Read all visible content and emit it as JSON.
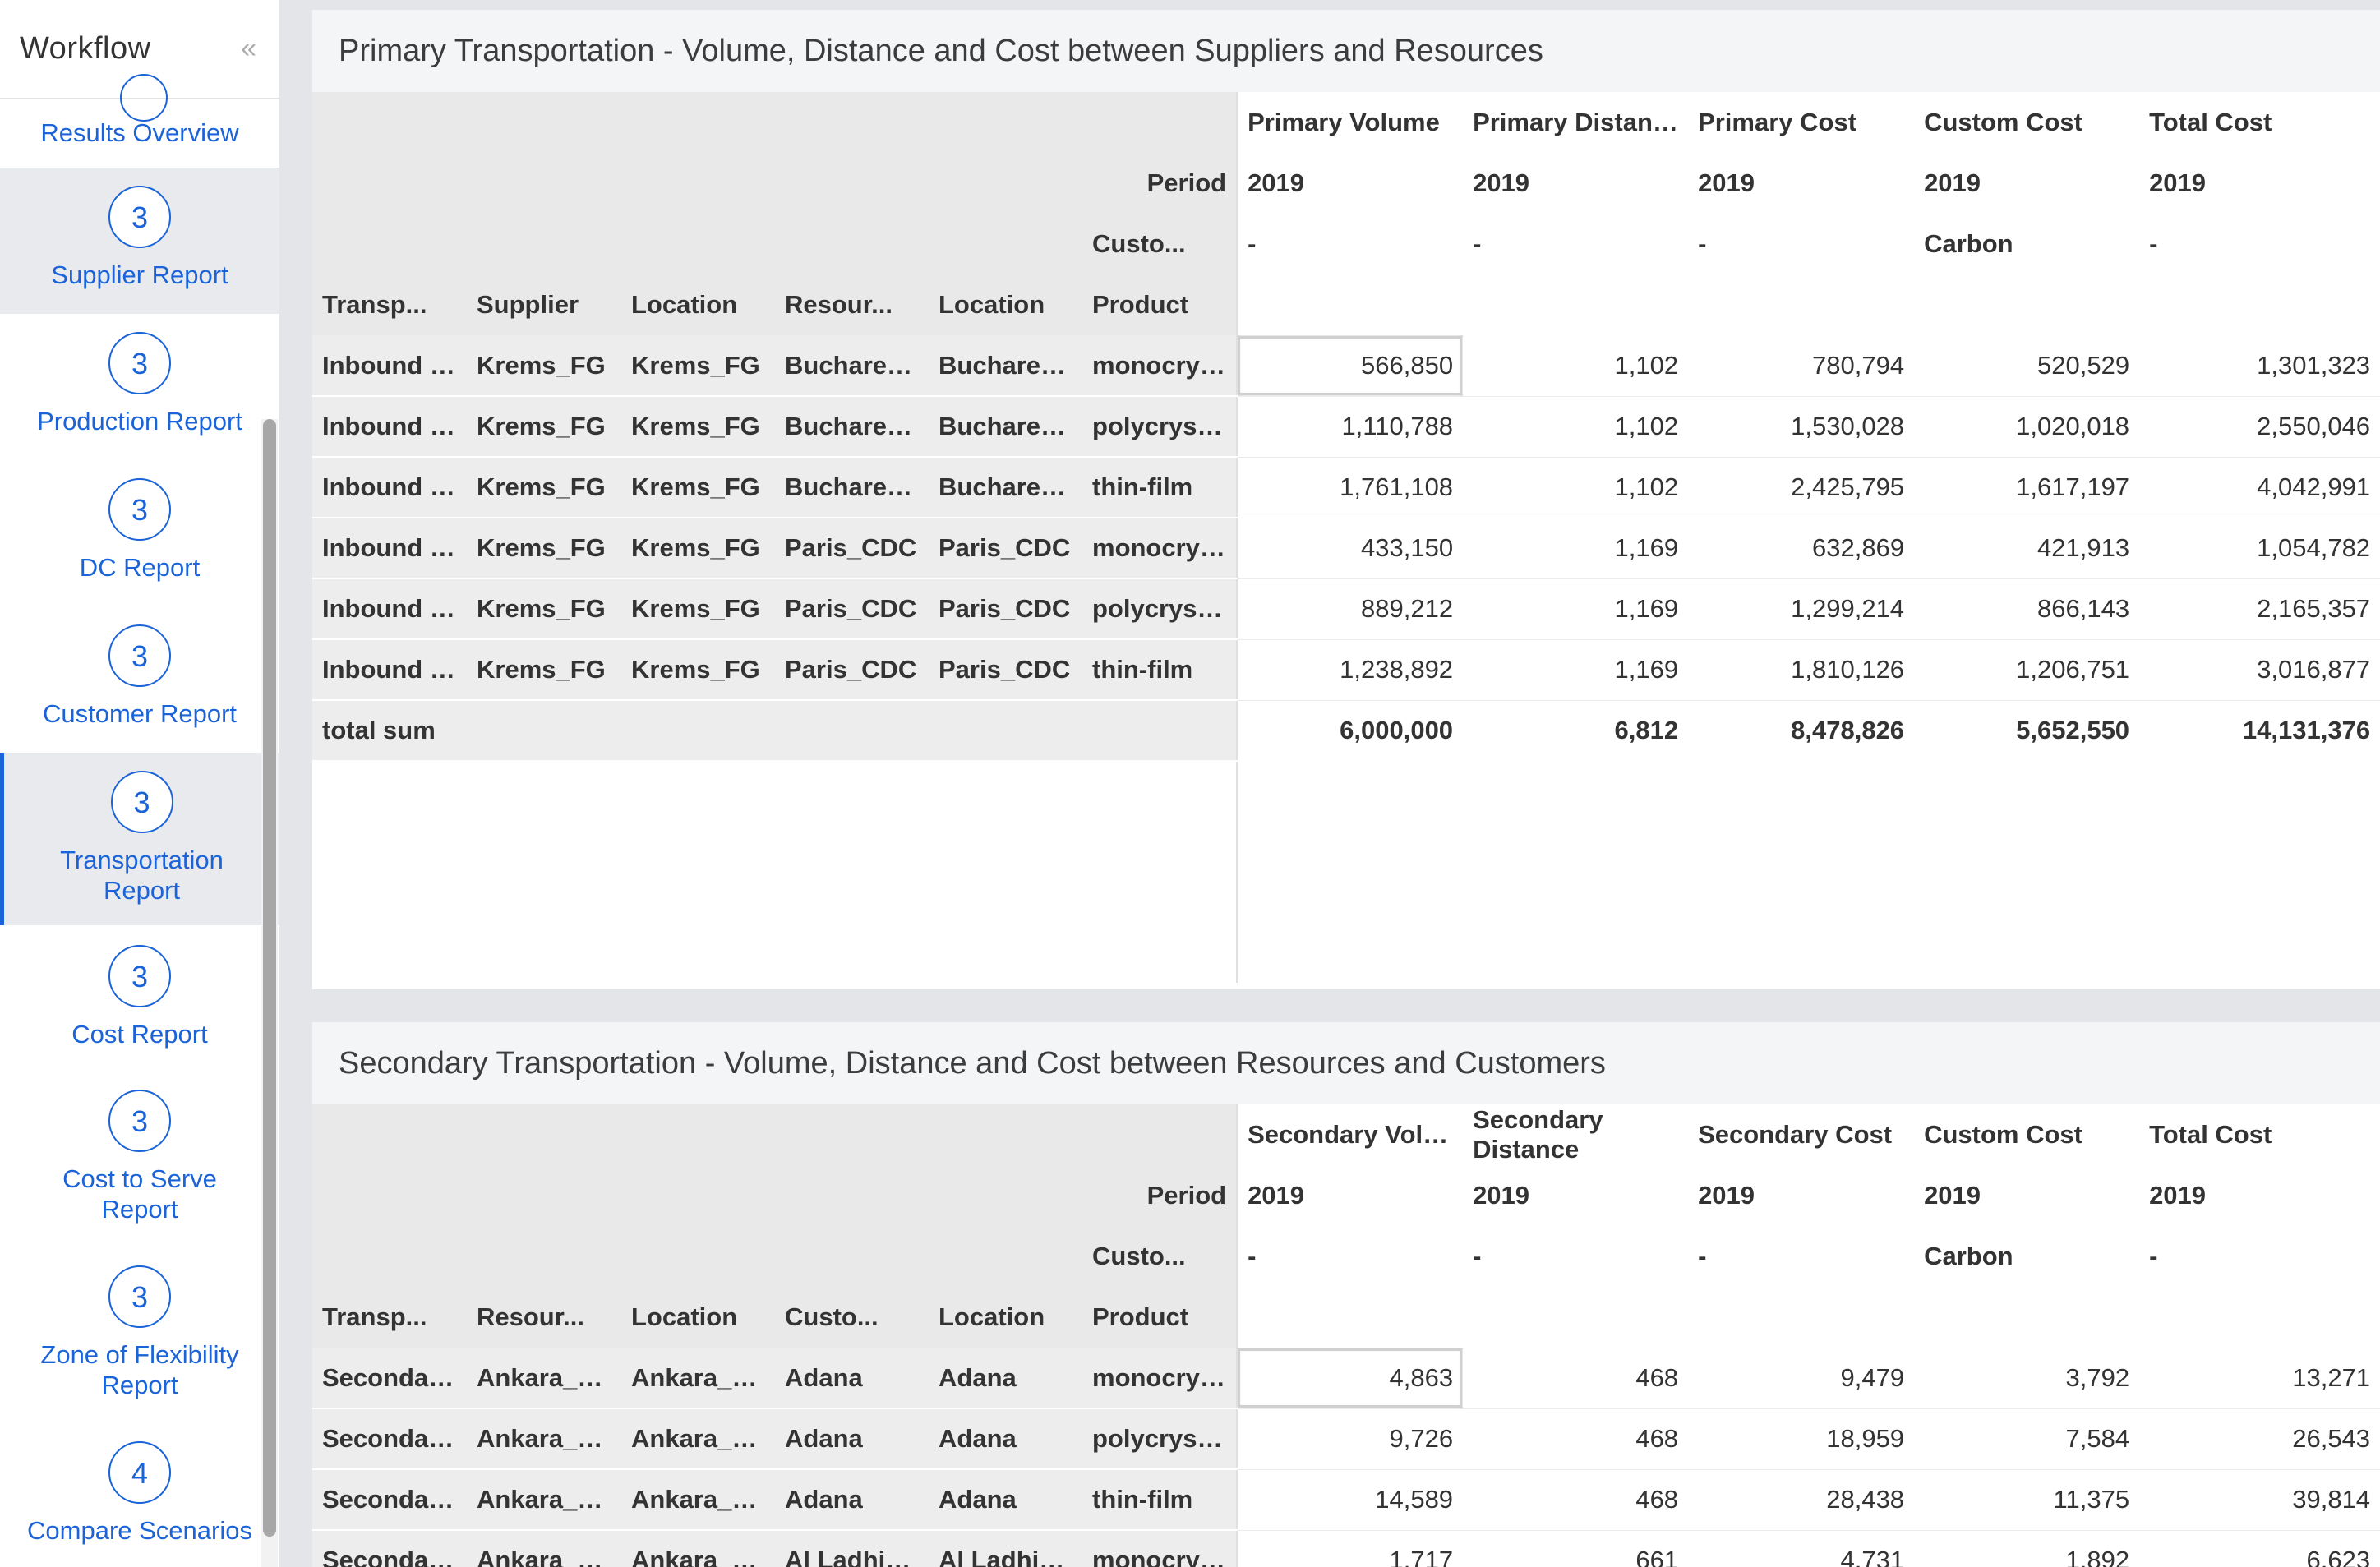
{
  "sidebar": {
    "title": "Workflow",
    "collapse_icon": "«",
    "results_overview": "Results Overview",
    "items": [
      {
        "num": "3",
        "label": "Supplier Report"
      },
      {
        "num": "3",
        "label": "Production Report"
      },
      {
        "num": "3",
        "label": "DC Report"
      },
      {
        "num": "3",
        "label": "Customer Report"
      },
      {
        "num": "3",
        "label": "Transportation Report"
      },
      {
        "num": "3",
        "label": "Cost Report"
      },
      {
        "num": "3",
        "label": "Cost to Serve Report"
      },
      {
        "num": "3",
        "label": "Zone of Flexibility Report"
      },
      {
        "num": "4",
        "label": "Compare Scenarios"
      }
    ]
  },
  "primary": {
    "title": "Primary Transportation - Volume, Distance and Cost between Suppliers and Resources",
    "period_label": "Period",
    "custo_label": "Custo...",
    "measures": [
      "Primary Volume",
      "Primary Distance",
      "Primary Cost",
      "Custom Cost",
      "Total Cost"
    ],
    "periods": [
      "2019",
      "2019",
      "2019",
      "2019",
      "2019"
    ],
    "custo_values": [
      "-",
      "-",
      "-",
      "Carbon",
      "-"
    ],
    "dim_headers": [
      "Transp...",
      "Supplier",
      "Location",
      "Resour...",
      "Location",
      "Product"
    ],
    "rows": [
      {
        "dims": [
          "Inbound F...",
          "Krems_FG",
          "Krems_FG",
          "Bucharest...",
          "Bucharest...",
          "monocrys..."
        ],
        "vals": [
          "566,850",
          "1,102",
          "780,794",
          "520,529",
          "1,301,323"
        ]
      },
      {
        "dims": [
          "Inbound F...",
          "Krems_FG",
          "Krems_FG",
          "Bucharest...",
          "Bucharest...",
          "polycrysta..."
        ],
        "vals": [
          "1,110,788",
          "1,102",
          "1,530,028",
          "1,020,018",
          "2,550,046"
        ]
      },
      {
        "dims": [
          "Inbound F...",
          "Krems_FG",
          "Krems_FG",
          "Bucharest...",
          "Bucharest...",
          "thin-film"
        ],
        "vals": [
          "1,761,108",
          "1,102",
          "2,425,795",
          "1,617,197",
          "4,042,991"
        ]
      },
      {
        "dims": [
          "Inbound F...",
          "Krems_FG",
          "Krems_FG",
          "Paris_CDC",
          "Paris_CDC",
          "monocrys..."
        ],
        "vals": [
          "433,150",
          "1,169",
          "632,869",
          "421,913",
          "1,054,782"
        ]
      },
      {
        "dims": [
          "Inbound F...",
          "Krems_FG",
          "Krems_FG",
          "Paris_CDC",
          "Paris_CDC",
          "polycrysta..."
        ],
        "vals": [
          "889,212",
          "1,169",
          "1,299,214",
          "866,143",
          "2,165,357"
        ]
      },
      {
        "dims": [
          "Inbound F...",
          "Krems_FG",
          "Krems_FG",
          "Paris_CDC",
          "Paris_CDC",
          "thin-film"
        ],
        "vals": [
          "1,238,892",
          "1,169",
          "1,810,126",
          "1,206,751",
          "3,016,877"
        ]
      }
    ],
    "total_label": "total sum",
    "totals": [
      "6,000,000",
      "6,812",
      "8,478,826",
      "5,652,550",
      "14,131,376"
    ]
  },
  "secondary": {
    "title": "Secondary Transportation - Volume, Distance and Cost between Resources and Customers",
    "period_label": "Period",
    "custo_label": "Custo...",
    "measures": [
      "Secondary Volume",
      "Secondary Distance",
      "Secondary Cost",
      "Custom Cost",
      "Total Cost"
    ],
    "periods": [
      "2019",
      "2019",
      "2019",
      "2019",
      "2019"
    ],
    "custo_values": [
      "-",
      "-",
      "-",
      "Carbon",
      "-"
    ],
    "dim_headers": [
      "Transp...",
      "Resour...",
      "Location",
      "Custo...",
      "Location",
      "Product"
    ],
    "rows": [
      {
        "dims": [
          "Secondar...",
          "Ankara_LDC",
          "Ankara_LDC",
          "Adana",
          "Adana",
          "monocrys..."
        ],
        "vals": [
          "4,863",
          "468",
          "9,479",
          "3,792",
          "13,271"
        ]
      },
      {
        "dims": [
          "Secondar...",
          "Ankara_LDC",
          "Ankara_LDC",
          "Adana",
          "Adana",
          "polycrysta..."
        ],
        "vals": [
          "9,726",
          "468",
          "18,959",
          "7,584",
          "26,543"
        ]
      },
      {
        "dims": [
          "Secondar...",
          "Ankara_LDC",
          "Ankara_LDC",
          "Adana",
          "Adana",
          "thin-film"
        ],
        "vals": [
          "14,589",
          "468",
          "28,438",
          "11,375",
          "39,814"
        ]
      },
      {
        "dims": [
          "Secondar...",
          "Ankara_LDC",
          "Ankara_LDC",
          "Al Ladhiqi...",
          "Al Ladhiqi...",
          "monocrys..."
        ],
        "vals": [
          "1,717",
          "661",
          "4,731",
          "1,892",
          "6,623"
        ]
      }
    ]
  }
}
